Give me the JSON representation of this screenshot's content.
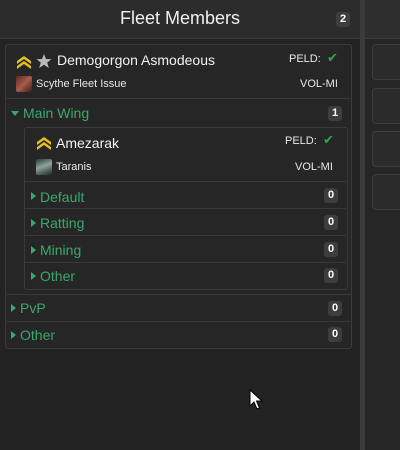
{
  "header": {
    "title": "Fleet Members",
    "count": "2"
  },
  "commander": {
    "name": "Demogorgon Asmodeous",
    "ship": "Scythe Fleet Issue",
    "status_label": "PELD:",
    "location": "VOL-MI",
    "icons": [
      "rank-chevrons-icon",
      "star-icon",
      "check-icon"
    ]
  },
  "main_wing": {
    "label": "Main Wing",
    "count": "1",
    "commander": {
      "name": "Amezarak",
      "ship": "Taranis",
      "status_label": "PELD:",
      "location": "VOL-MI"
    },
    "squads": [
      {
        "label": "Default",
        "count": "0"
      },
      {
        "label": "Ratting",
        "count": "0"
      },
      {
        "label": "Mining",
        "count": "0"
      },
      {
        "label": "Other",
        "count": "0"
      }
    ]
  },
  "other_wings": [
    {
      "label": "PvP",
      "count": "0"
    },
    {
      "label": "Other",
      "count": "0"
    }
  ],
  "colors": {
    "accent_green": "#3aa86b",
    "check_green": "#2fa84f",
    "rank_gold": "#e6c21e"
  }
}
